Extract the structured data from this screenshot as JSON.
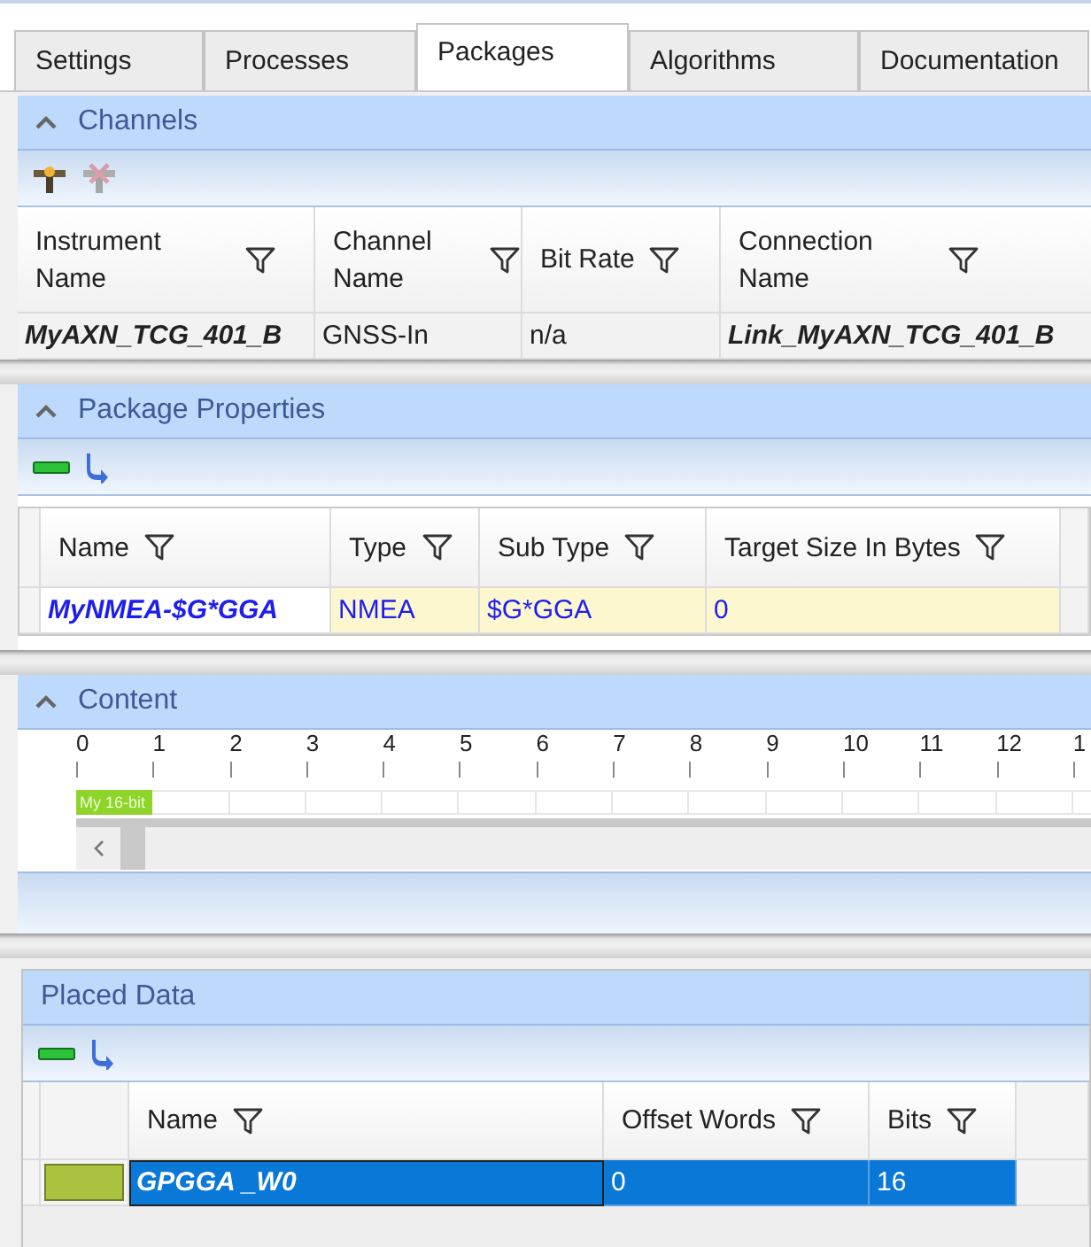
{
  "tabs": [
    {
      "label": "Settings",
      "selected": false
    },
    {
      "label": "Processes",
      "selected": false
    },
    {
      "label": "Packages",
      "selected": true
    },
    {
      "label": "Algorithms",
      "selected": false
    },
    {
      "label": "Documentation",
      "selected": false
    }
  ],
  "channels": {
    "title": "Channels",
    "expanded": true,
    "toolbar": [
      {
        "kind": "plug",
        "disabled": false
      },
      {
        "kind": "plug-remove",
        "disabled": true
      }
    ],
    "table": {
      "columns": [
        "Instrument Name",
        "Channel Name",
        "Bit Rate",
        "Connection Name"
      ],
      "rows": [
        {
          "cells": [
            {
              "text": "MyAXN_TCG_401_B",
              "emphasis": true
            },
            {
              "text": "GNSS-In",
              "emphasis": false
            },
            {
              "text": "n/a",
              "emphasis": false
            },
            {
              "text": "Link_MyAXN_TCG_401_B",
              "emphasis": true
            }
          ]
        }
      ]
    }
  },
  "package_properties": {
    "title": "Package Properties",
    "expanded": true,
    "toolbar": [
      {
        "kind": "bar",
        "disabled": false
      },
      {
        "kind": "arrow",
        "disabled": false
      }
    ],
    "table": {
      "columns": [
        "Name",
        "Type",
        "Sub Type",
        "Target Size In Bytes"
      ],
      "rows": [
        {
          "dirty": true,
          "cells": [
            {
              "text": "MyNMEA-$G*GGA",
              "emphasis": true,
              "highlighted": false
            },
            {
              "text": "NMEA",
              "emphasis": false,
              "highlighted": true
            },
            {
              "text": "$G*GGA",
              "emphasis": false,
              "highlighted": true
            },
            {
              "text": "0",
              "emphasis": false,
              "highlighted": true
            }
          ]
        }
      ]
    }
  },
  "content": {
    "title": "Content",
    "expanded": true,
    "ruler": [
      "0",
      "1",
      "2",
      "3",
      "4",
      "5",
      "6",
      "7",
      "8",
      "9",
      "10",
      "11",
      "12",
      "1"
    ],
    "fields": [
      {
        "label": "My 16-bit",
        "color": "#8fd42a"
      }
    ]
  },
  "placed_data": {
    "title": "Placed Data",
    "toolbar": [
      {
        "kind": "bar",
        "disabled": false
      },
      {
        "kind": "arrow",
        "disabled": false
      }
    ],
    "table": {
      "columns": [
        "Name",
        "Offset Words",
        "Bits"
      ],
      "rows": [
        {
          "selected": true,
          "color": "#a9c23f",
          "cells": [
            {
              "text": "GPGGA _W0",
              "emphasis": true
            },
            {
              "text": "0",
              "emphasis": false
            },
            {
              "text": "16",
              "emphasis": false
            }
          ]
        }
      ]
    }
  }
}
